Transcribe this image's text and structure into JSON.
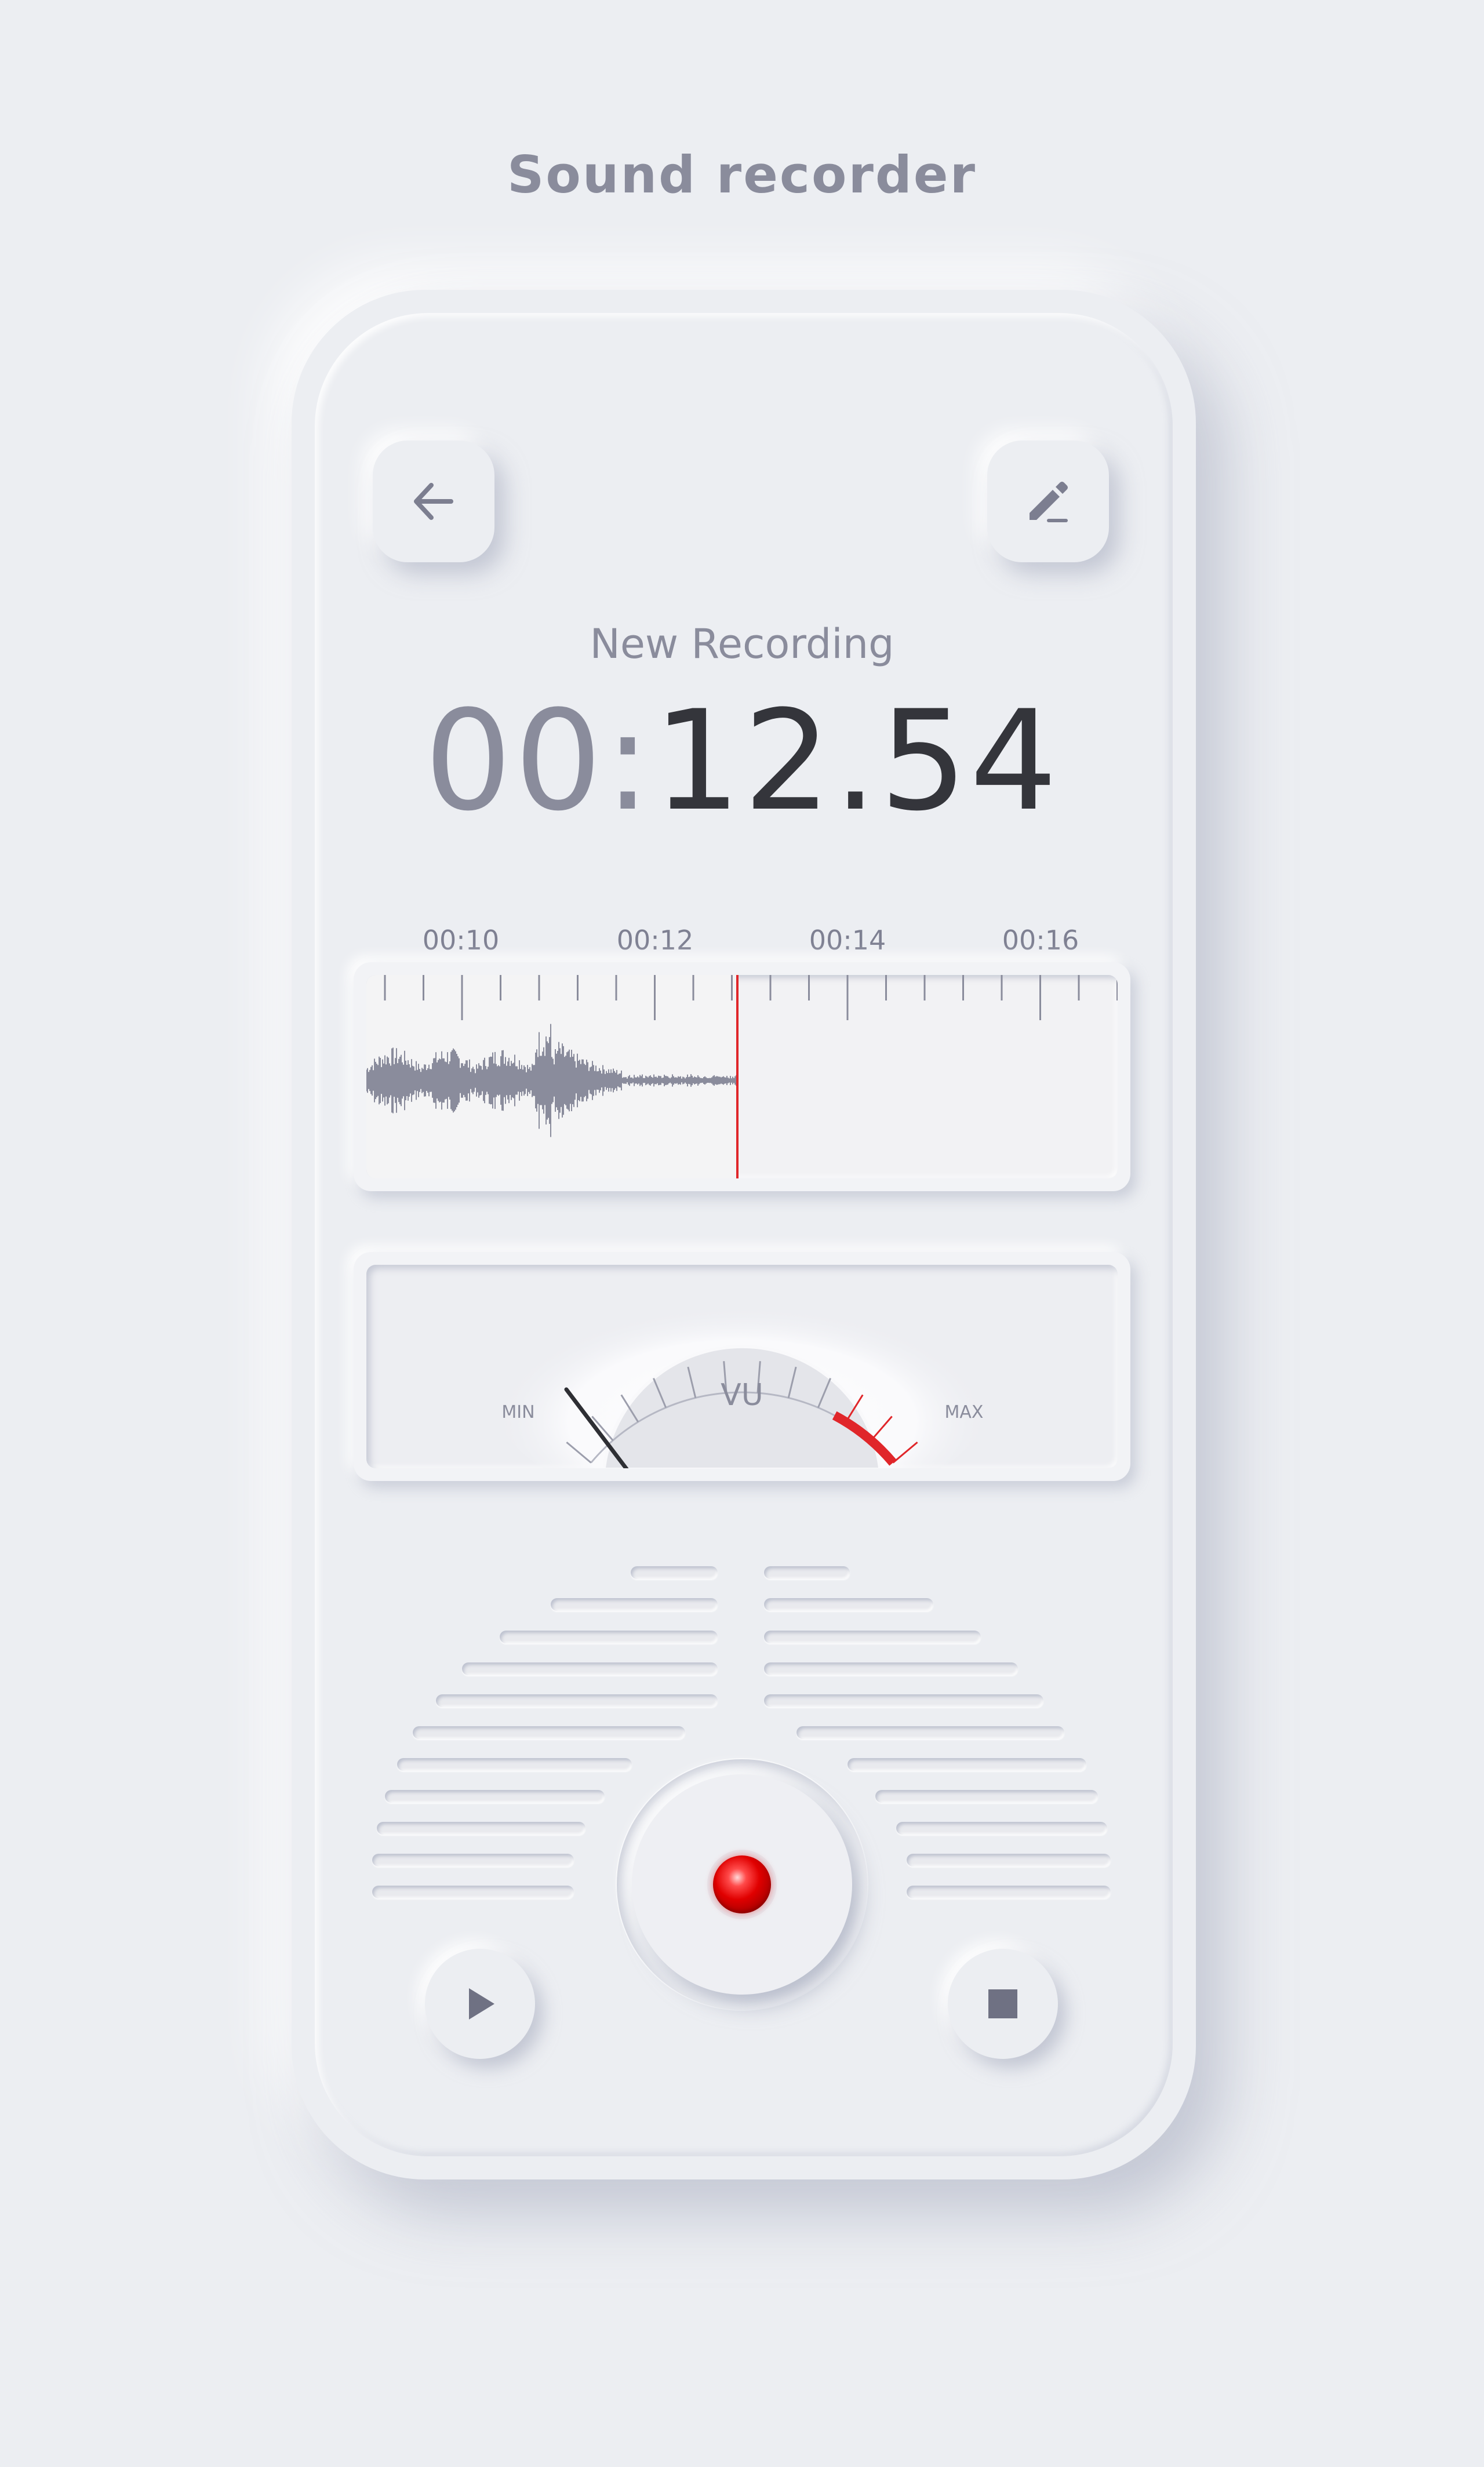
{
  "page": {
    "title": "Sound recorder"
  },
  "recording": {
    "name": "New Recording",
    "timer_minutes": "00:",
    "timer_rest": "12.54"
  },
  "timeline": {
    "labels": [
      "00:10",
      "00:12",
      "00:14",
      "00:16"
    ]
  },
  "vu_meter": {
    "label": "VU",
    "min_label": "MIN",
    "max_label": "MAX",
    "level": 0.0
  },
  "colors": {
    "background": "#eceef2",
    "accent": "#e0262a",
    "text_primary": "#34353b",
    "text_secondary": "#8a8c9c",
    "waveform": "#8a8c9c"
  },
  "icons": {
    "back": "arrow-left-icon",
    "edit": "pencil-edit-icon",
    "play": "play-icon",
    "stop": "stop-icon",
    "record": "record-icon"
  }
}
